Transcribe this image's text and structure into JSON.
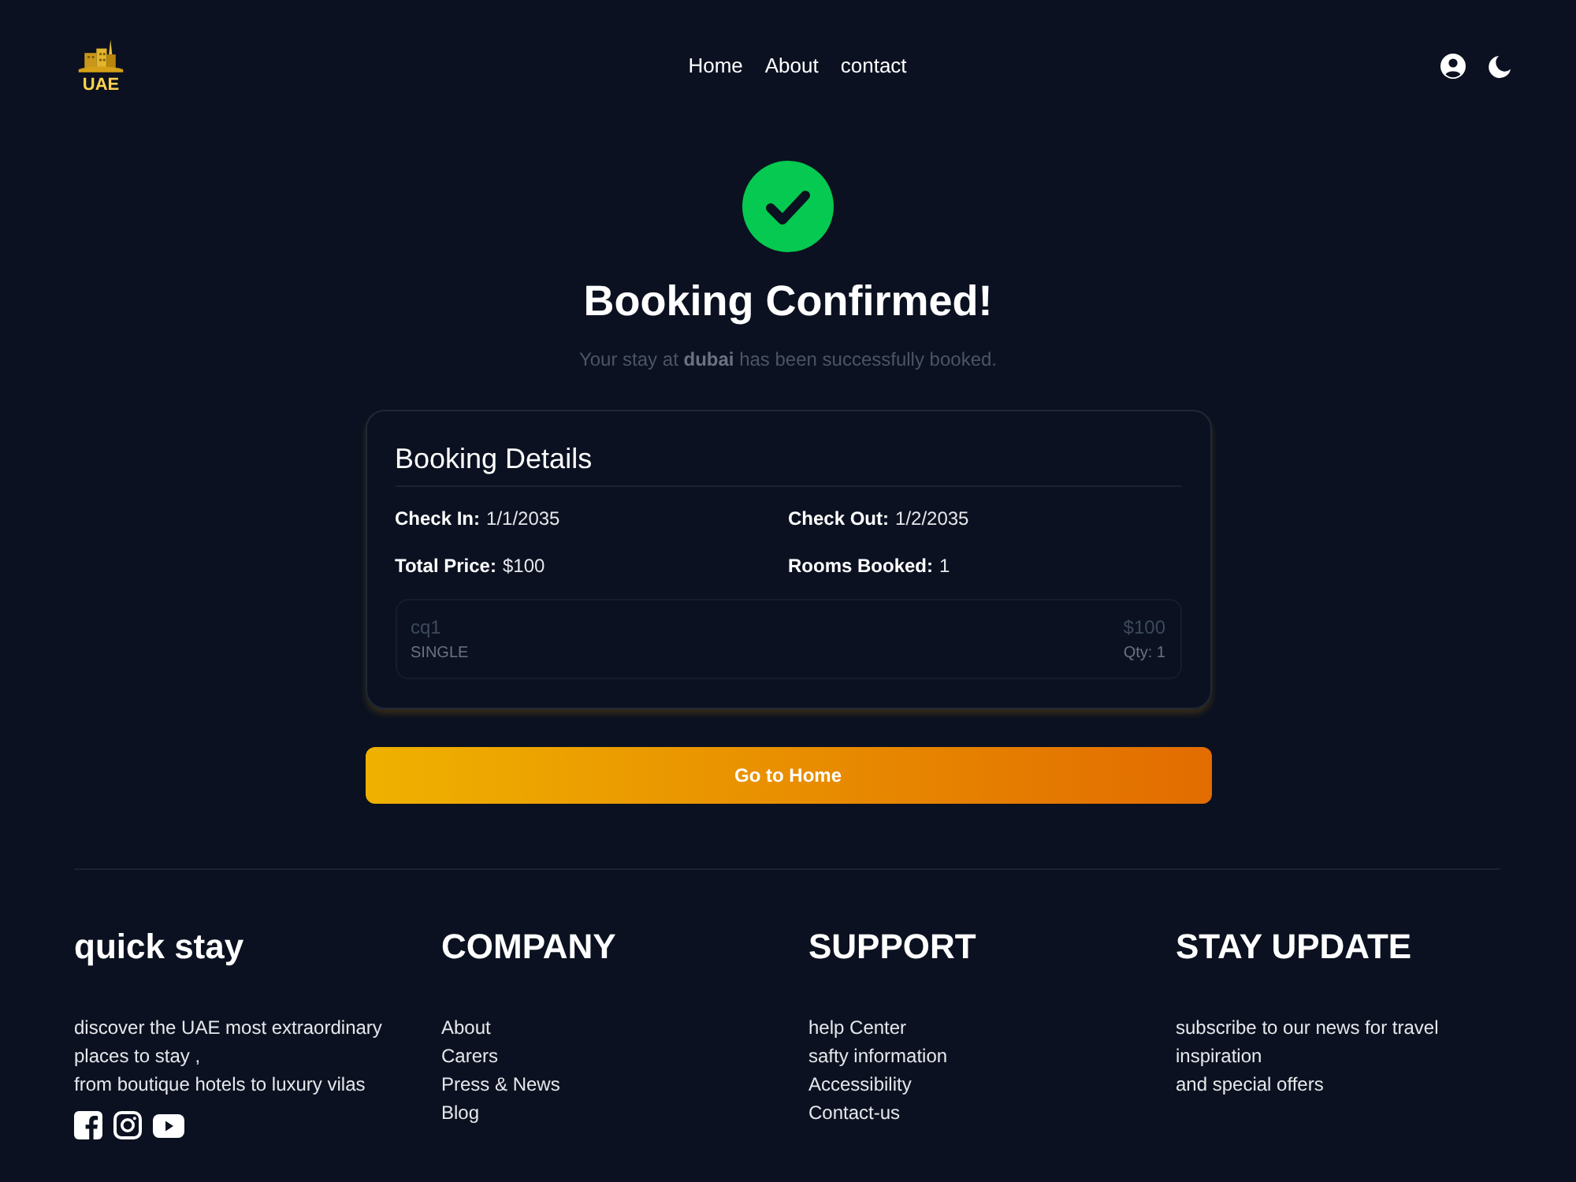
{
  "header": {
    "logo_text": "UAE",
    "nav": [
      {
        "label": "Home"
      },
      {
        "label": "About"
      },
      {
        "label": "contact"
      }
    ]
  },
  "confirmation": {
    "title": "Booking Confirmed!",
    "message": "Your stay at **dubai** has been successfully booked."
  },
  "details": {
    "title": "Booking Details",
    "fields": [
      {
        "label": "Check In:",
        "value": "1/1/2035"
      },
      {
        "label": "Check Out:",
        "value": "1/2/2035"
      },
      {
        "label": "Total Price:",
        "value": "$100"
      },
      {
        "label": "Rooms Booked:",
        "value": "1"
      }
    ],
    "rooms": [
      {
        "name": "cq1",
        "price": "$100",
        "type": "SINGLE",
        "quantity": "Qty: 1"
      }
    ]
  },
  "home_button": "Go to Home",
  "footer": {
    "columns": [
      {
        "kind": "about",
        "title": "quick stay",
        "text": "discover the UAE most extraordinary places to stay ,\nfrom boutique hotels to luxury vilas"
      },
      {
        "kind": "links",
        "title": "COMPANY",
        "links": [
          "About",
          "Carers",
          "Press & News",
          "Blog"
        ]
      },
      {
        "kind": "links",
        "title": "SUPPORT",
        "links": [
          "help Center",
          "safty information",
          "Accessibility",
          "Contact-us"
        ]
      },
      {
        "kind": "newsletter",
        "title": "STAY UPDATE",
        "text": "subscribe to our news for travel inspiration\nand special offers"
      }
    ]
  }
}
